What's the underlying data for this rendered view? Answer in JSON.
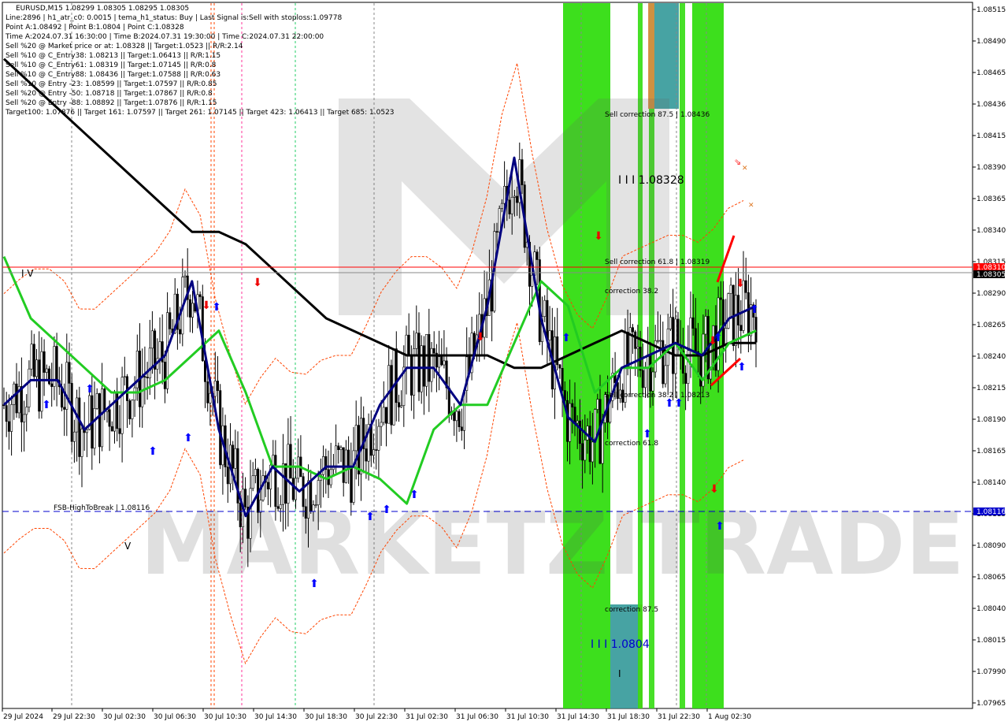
{
  "window": {
    "header": "EURUSD,M15  1.08299 1.08305 1.08295 1.08305",
    "info_lines": [
      "Line:2896 | h1_atr_c0: 0.0015 | tema_h1_status: Buy | Last Signal is:Sell with stoploss:1.09778",
      "Point A:1.08492 | Point B:1.0804 | Point C:1.08328",
      "Time A:2024.07.31 16:30:00 | Time B:2024.07.31 19:30:00 | Time C:2024.07.31 22:00:00",
      "Sell %20 @ Market price or at: 1.08328 || Target:1.0523 || R/R:2.14",
      "Sell %10 @ C_Entry38: 1.08213 || Target:1.06413 || R/R:1.15",
      "Sell %10 @ C_Entry61: 1.08319 || Target:1.07145 || R/R:0.8",
      "Sell %10 @ C_Entry88: 1.08436 || Target:1.07588 || R/R:0.63",
      "Sell %10 @ Entry -23: 1.08599 || Target:1.07597 || R/R:0.85",
      "Sell %20 @ Entry -50: 1.08718 || Target:1.07867 || R/R:0.8",
      "Sell %20 @ Entry -88: 1.08892 || Target:1.07876 || R/R:1.15",
      "Target100: 1.07876 || Target 161: 1.07597 || Target 261: 1.07145 || Target 423: 1.06413 || Target 685: 1.0523"
    ],
    "watermark": "MARKETZITRADE"
  },
  "annotations": {
    "sell_corr_875": "Sell correction 87.5 | 1.08436",
    "level_c": "I I I 1.08328",
    "sell_corr_618": "Sell correction 61.8 | 1.08319",
    "corr_382_top": "correction 38.2",
    "sell_corr_382": "Sell correction 38.2 | 1.08213",
    "corr_618_bottom": "correction 61.8",
    "corr_875_bottom": "correction 87.5",
    "level_b": "I I I 1.0804",
    "fsb": "FSB-HighToBreak | 1.08116",
    "roman_iv": "I V",
    "roman_v": "V",
    "marker_i": "I",
    "price_tag_red": "1.08310",
    "price_tag_black": "1.08305",
    "price_tag_blue": "1.08116"
  },
  "colors": {
    "candle_up": "#000000",
    "candle_down": "#000000",
    "ma_long": "#000000",
    "ma_green": "#22cc22",
    "ma_navy": "#000080",
    "envelope": "#ff4400",
    "zone_green": "#33dd11",
    "zone_teal": "#339999",
    "zone_orange": "#dd8844",
    "red_line": "#ff0000",
    "fsb_line": "#0000cc"
  },
  "chart_data": {
    "type": "line",
    "symbol": "EURUSD",
    "timeframe": "M15",
    "price_axis_ticks": [
      "1.08515",
      "1.08490",
      "1.08465",
      "1.08436",
      "1.08415",
      "1.08390",
      "1.08365",
      "1.08340",
      "1.08315",
      "1.08290",
      "1.08265",
      "1.08240",
      "1.08215",
      "1.08190",
      "1.08165",
      "1.08140",
      "1.08115",
      "1.08090",
      "1.08065",
      "1.08040",
      "1.08015",
      "1.07990",
      "1.07965"
    ],
    "ylim": [
      1.0796,
      1.0852
    ],
    "time_axis_ticks": [
      "29 Jul 2024",
      "29 Jul 22:30",
      "30 Jul 02:30",
      "30 Jul 06:30",
      "30 Jul 10:30",
      "30 Jul 14:30",
      "30 Jul 18:30",
      "30 Jul 22:30",
      "31 Jul 02:30",
      "31 Jul 06:30",
      "31 Jul 10:30",
      "31 Jul 14:30",
      "31 Jul 18:30",
      "31 Jul 22:30",
      "1 Aug 02:30"
    ],
    "levels": {
      "red_horizontal": 1.0831,
      "black_horizontal": 1.08305,
      "fsb_high_to_break": 1.08116
    },
    "series": [
      {
        "name": "",
        "role": "ma_long",
        "values": [
          1.0848,
          1.0846,
          1.0844,
          1.0842,
          1.084,
          1.0838,
          1.0836,
          1.0834,
          1.0834,
          1.0833,
          1.0831,
          1.0829,
          1.0827,
          1.0826,
          1.0825,
          1.0824,
          1.0824,
          1.0824,
          1.0824,
          1.0823,
          1.0823,
          1.0824,
          1.0825,
          1.0826,
          1.0825,
          1.0824,
          1.0824,
          1.0825,
          1.0825
        ]
      },
      {
        "name": "",
        "role": "ma_green",
        "values": [
          1.0832,
          1.0827,
          1.0825,
          1.0823,
          1.0821,
          1.0821,
          1.0822,
          1.0824,
          1.0826,
          1.0821,
          1.0815,
          1.0815,
          1.0814,
          1.0815,
          1.0814,
          1.0812,
          1.0818,
          1.082,
          1.082,
          1.0825,
          1.083,
          1.0828,
          1.0821,
          1.0823,
          1.0823,
          1.0825,
          1.0822,
          1.0825,
          1.0826
        ]
      },
      {
        "name": "",
        "role": "ma_navy",
        "values": [
          1.082,
          1.0822,
          1.0822,
          1.0818,
          1.082,
          1.0822,
          1.0824,
          1.083,
          1.0818,
          1.0811,
          1.0815,
          1.0813,
          1.0815,
          1.0815,
          1.082,
          1.0823,
          1.0823,
          1.082,
          1.0828,
          1.084,
          1.0827,
          1.0819,
          1.0817,
          1.0823,
          1.0824,
          1.0825,
          1.0824,
          1.0827,
          1.0828
        ]
      }
    ]
  }
}
